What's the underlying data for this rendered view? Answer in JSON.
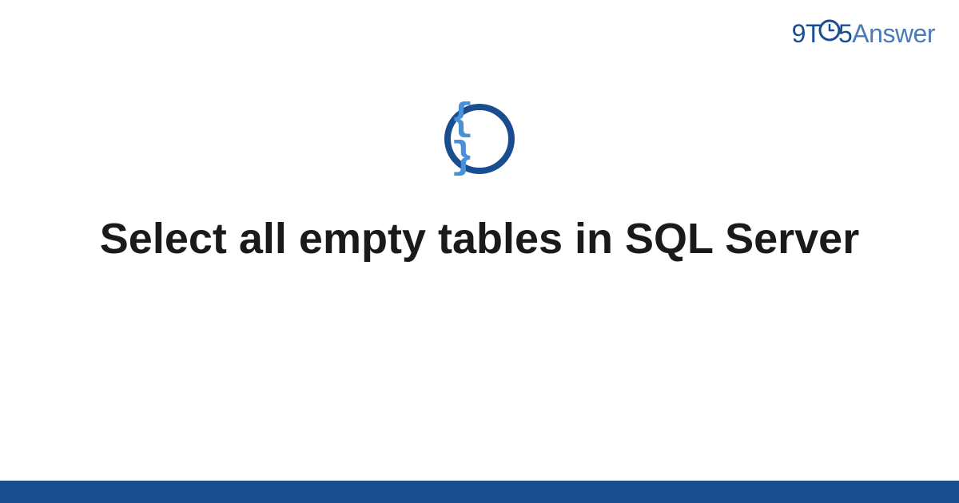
{
  "header": {
    "logo_nine": "9",
    "logo_t": "T",
    "logo_five": "5",
    "logo_answer": "Answer"
  },
  "main": {
    "icon_braces": "{ }",
    "title": "Select all empty tables in SQL Server"
  },
  "colors": {
    "primary_dark": "#1a4d8f",
    "primary_light": "#4a90d9",
    "text_dark": "#1a1a1a"
  }
}
